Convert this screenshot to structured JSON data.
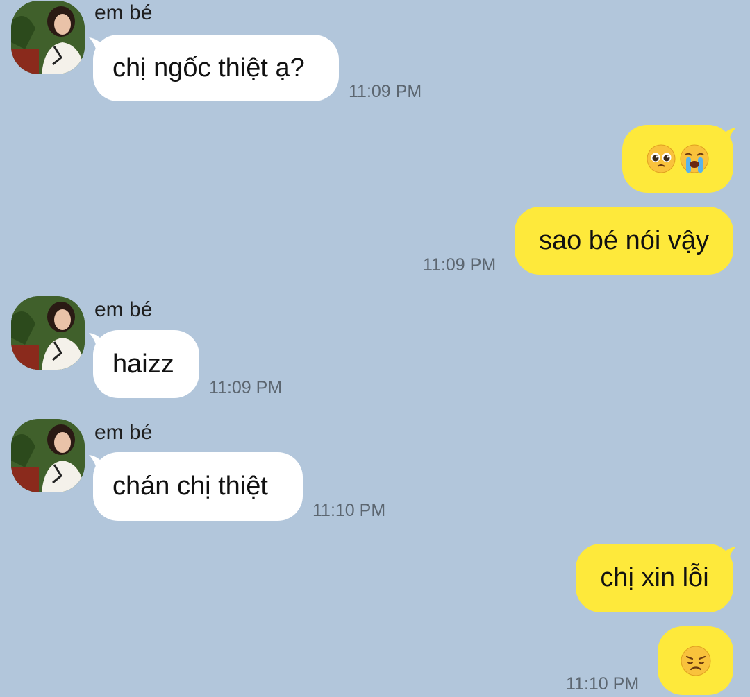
{
  "chat": {
    "messages": [
      {
        "sender": "em bé",
        "text": "chị ngốc thiệt ạ?",
        "time": "11:09 PM"
      },
      {
        "emojis": [
          "pleading-face",
          "loudly-crying-face"
        ]
      },
      {
        "text": "sao bé nói vậy",
        "time": "11:09 PM"
      },
      {
        "sender": "em bé",
        "text": "haizz",
        "time": "11:09 PM"
      },
      {
        "sender": "em bé",
        "text": "chán chị thiệt",
        "time": "11:10 PM"
      },
      {
        "text": "chị xin lỗi"
      },
      {
        "emojis": [
          "disappointed-face"
        ],
        "time": "11:10 PM"
      }
    ]
  },
  "colors": {
    "background": "#b2c6db",
    "incoming_bubble": "#ffffff",
    "outgoing_bubble": "#fee93b",
    "timestamp": "#5c6670"
  }
}
